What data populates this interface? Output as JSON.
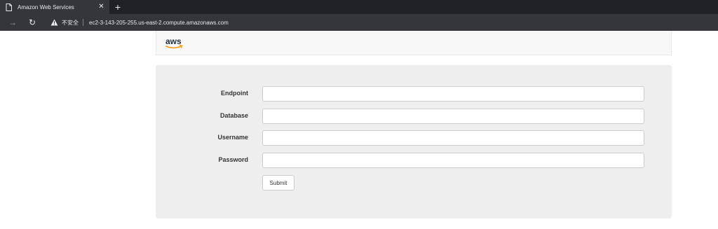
{
  "browser": {
    "tab_title": "Amazon Web Services",
    "close_glyph": "✕",
    "new_tab_glyph": "+",
    "forward_glyph": "→",
    "reload_glyph": "↻",
    "security_label": "不安全",
    "url": "ec2-3-143-205-255.us-east-2.compute.amazonaws.com"
  },
  "header": {
    "logo_text": "aws",
    "logo_icon": "aws-smile-logo",
    "accent_color": "#ff9900"
  },
  "form": {
    "fields": [
      {
        "label": "Endpoint",
        "value": ""
      },
      {
        "label": "Database",
        "value": ""
      },
      {
        "label": "Username",
        "value": ""
      },
      {
        "label": "Password",
        "value": ""
      }
    ],
    "submit_label": "Submit"
  }
}
